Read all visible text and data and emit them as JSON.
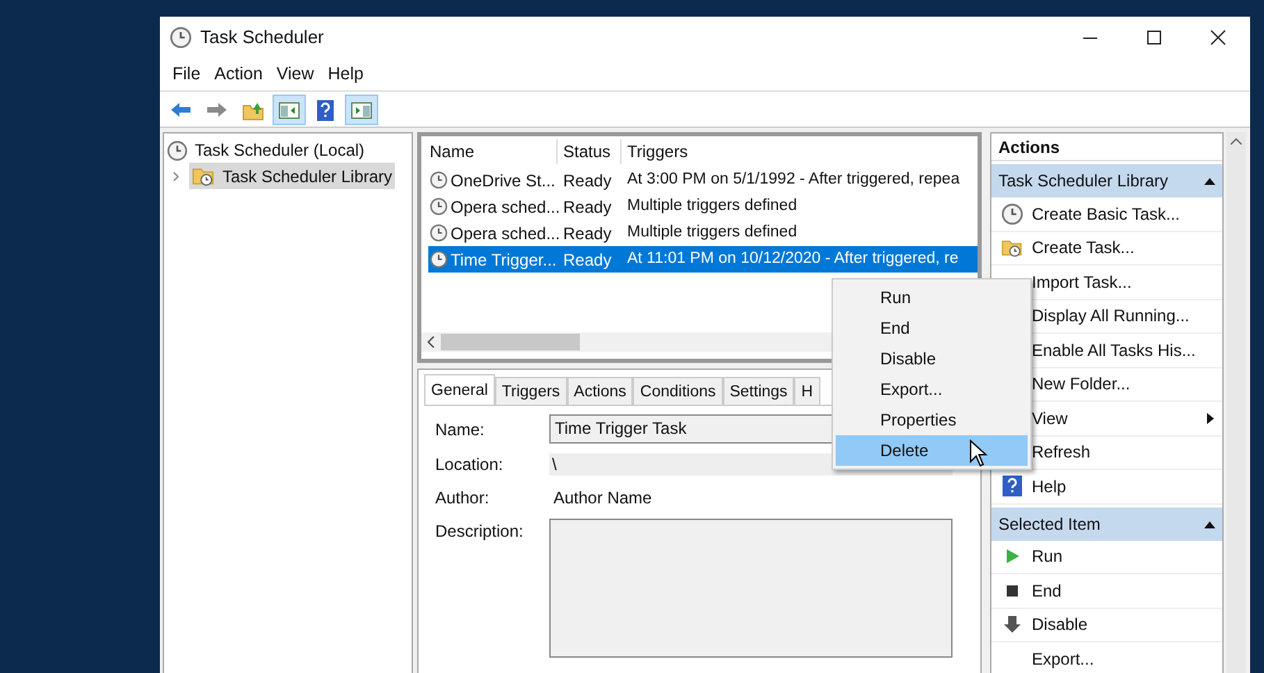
{
  "window": {
    "title": "Task Scheduler"
  },
  "menu": [
    "File",
    "Action",
    "View",
    "Help"
  ],
  "toolbar": [
    {
      "kind": "back"
    },
    {
      "kind": "forward"
    },
    {
      "kind": "folder-up"
    },
    {
      "kind": "pane-left",
      "selected": true
    },
    {
      "kind": "help"
    },
    {
      "kind": "pane-right",
      "selected": true
    }
  ],
  "tree": [
    {
      "label": "Task Scheduler (Local)",
      "selected": false,
      "children": [
        {
          "label": "Task Scheduler Library",
          "selected": true
        }
      ]
    }
  ],
  "task_list": {
    "columns": [
      "Name",
      "Status",
      "Triggers"
    ],
    "rows": [
      {
        "name": "OneDrive St...",
        "status": "Ready",
        "triggers": "At 3:00 PM on 5/1/1992 - After triggered, repea",
        "selected": false
      },
      {
        "name": "Opera sched...",
        "status": "Ready",
        "triggers": "Multiple triggers defined",
        "selected": false
      },
      {
        "name": "Opera sched...",
        "status": "Ready",
        "triggers": "Multiple triggers defined",
        "selected": false
      },
      {
        "name": "Time Trigger...",
        "status": "Ready",
        "triggers": "At 11:01 PM on 10/12/2020 - After triggered, re",
        "selected": true
      }
    ]
  },
  "detail_tabs": [
    {
      "label": "General",
      "selected": true
    },
    {
      "label": "Triggers",
      "selected": false
    },
    {
      "label": "Actions",
      "selected": false
    },
    {
      "label": "Conditions",
      "selected": false
    },
    {
      "label": "Settings",
      "selected": false
    },
    {
      "label": "H",
      "selected": false
    }
  ],
  "general": {
    "name_label": "Name:",
    "name_value": "Time Trigger Task",
    "location_label": "Location:",
    "location_value": "\\",
    "author_label": "Author:",
    "author_value": "Author Name",
    "description_label": "Description:"
  },
  "context_menu": [
    {
      "label": "Run",
      "selected": false
    },
    {
      "label": "End",
      "selected": false
    },
    {
      "label": "Disable",
      "selected": false
    },
    {
      "label": "Export...",
      "selected": false
    },
    {
      "label": "Properties",
      "selected": false
    },
    {
      "label": "Delete",
      "selected": true
    }
  ],
  "actions_pane": {
    "title": "Actions",
    "groups": [
      {
        "title": "Task Scheduler Library",
        "expanded": true,
        "items": [
          {
            "label": "Create Basic Task...",
            "kind": "clock"
          },
          {
            "label": "Create Task...",
            "kind": "folder-clock"
          },
          {
            "label": "Import Task...",
            "kind": "plain"
          },
          {
            "label": "Display All Running...",
            "kind": "plain"
          },
          {
            "label": "Enable All Tasks His...",
            "kind": "plain"
          },
          {
            "label": "New Folder...",
            "kind": "plain"
          },
          {
            "label": "View",
            "kind": "submenu"
          },
          {
            "label": "Refresh",
            "kind": "plain"
          },
          {
            "label": "Help",
            "kind": "help"
          }
        ]
      },
      {
        "title": "Selected Item",
        "expanded": true,
        "items": [
          {
            "label": "Run",
            "kind": "run"
          },
          {
            "label": "End",
            "kind": "stop"
          },
          {
            "label": "Disable",
            "kind": "down"
          },
          {
            "label": "Export...",
            "kind": "plain"
          }
        ]
      }
    ]
  }
}
